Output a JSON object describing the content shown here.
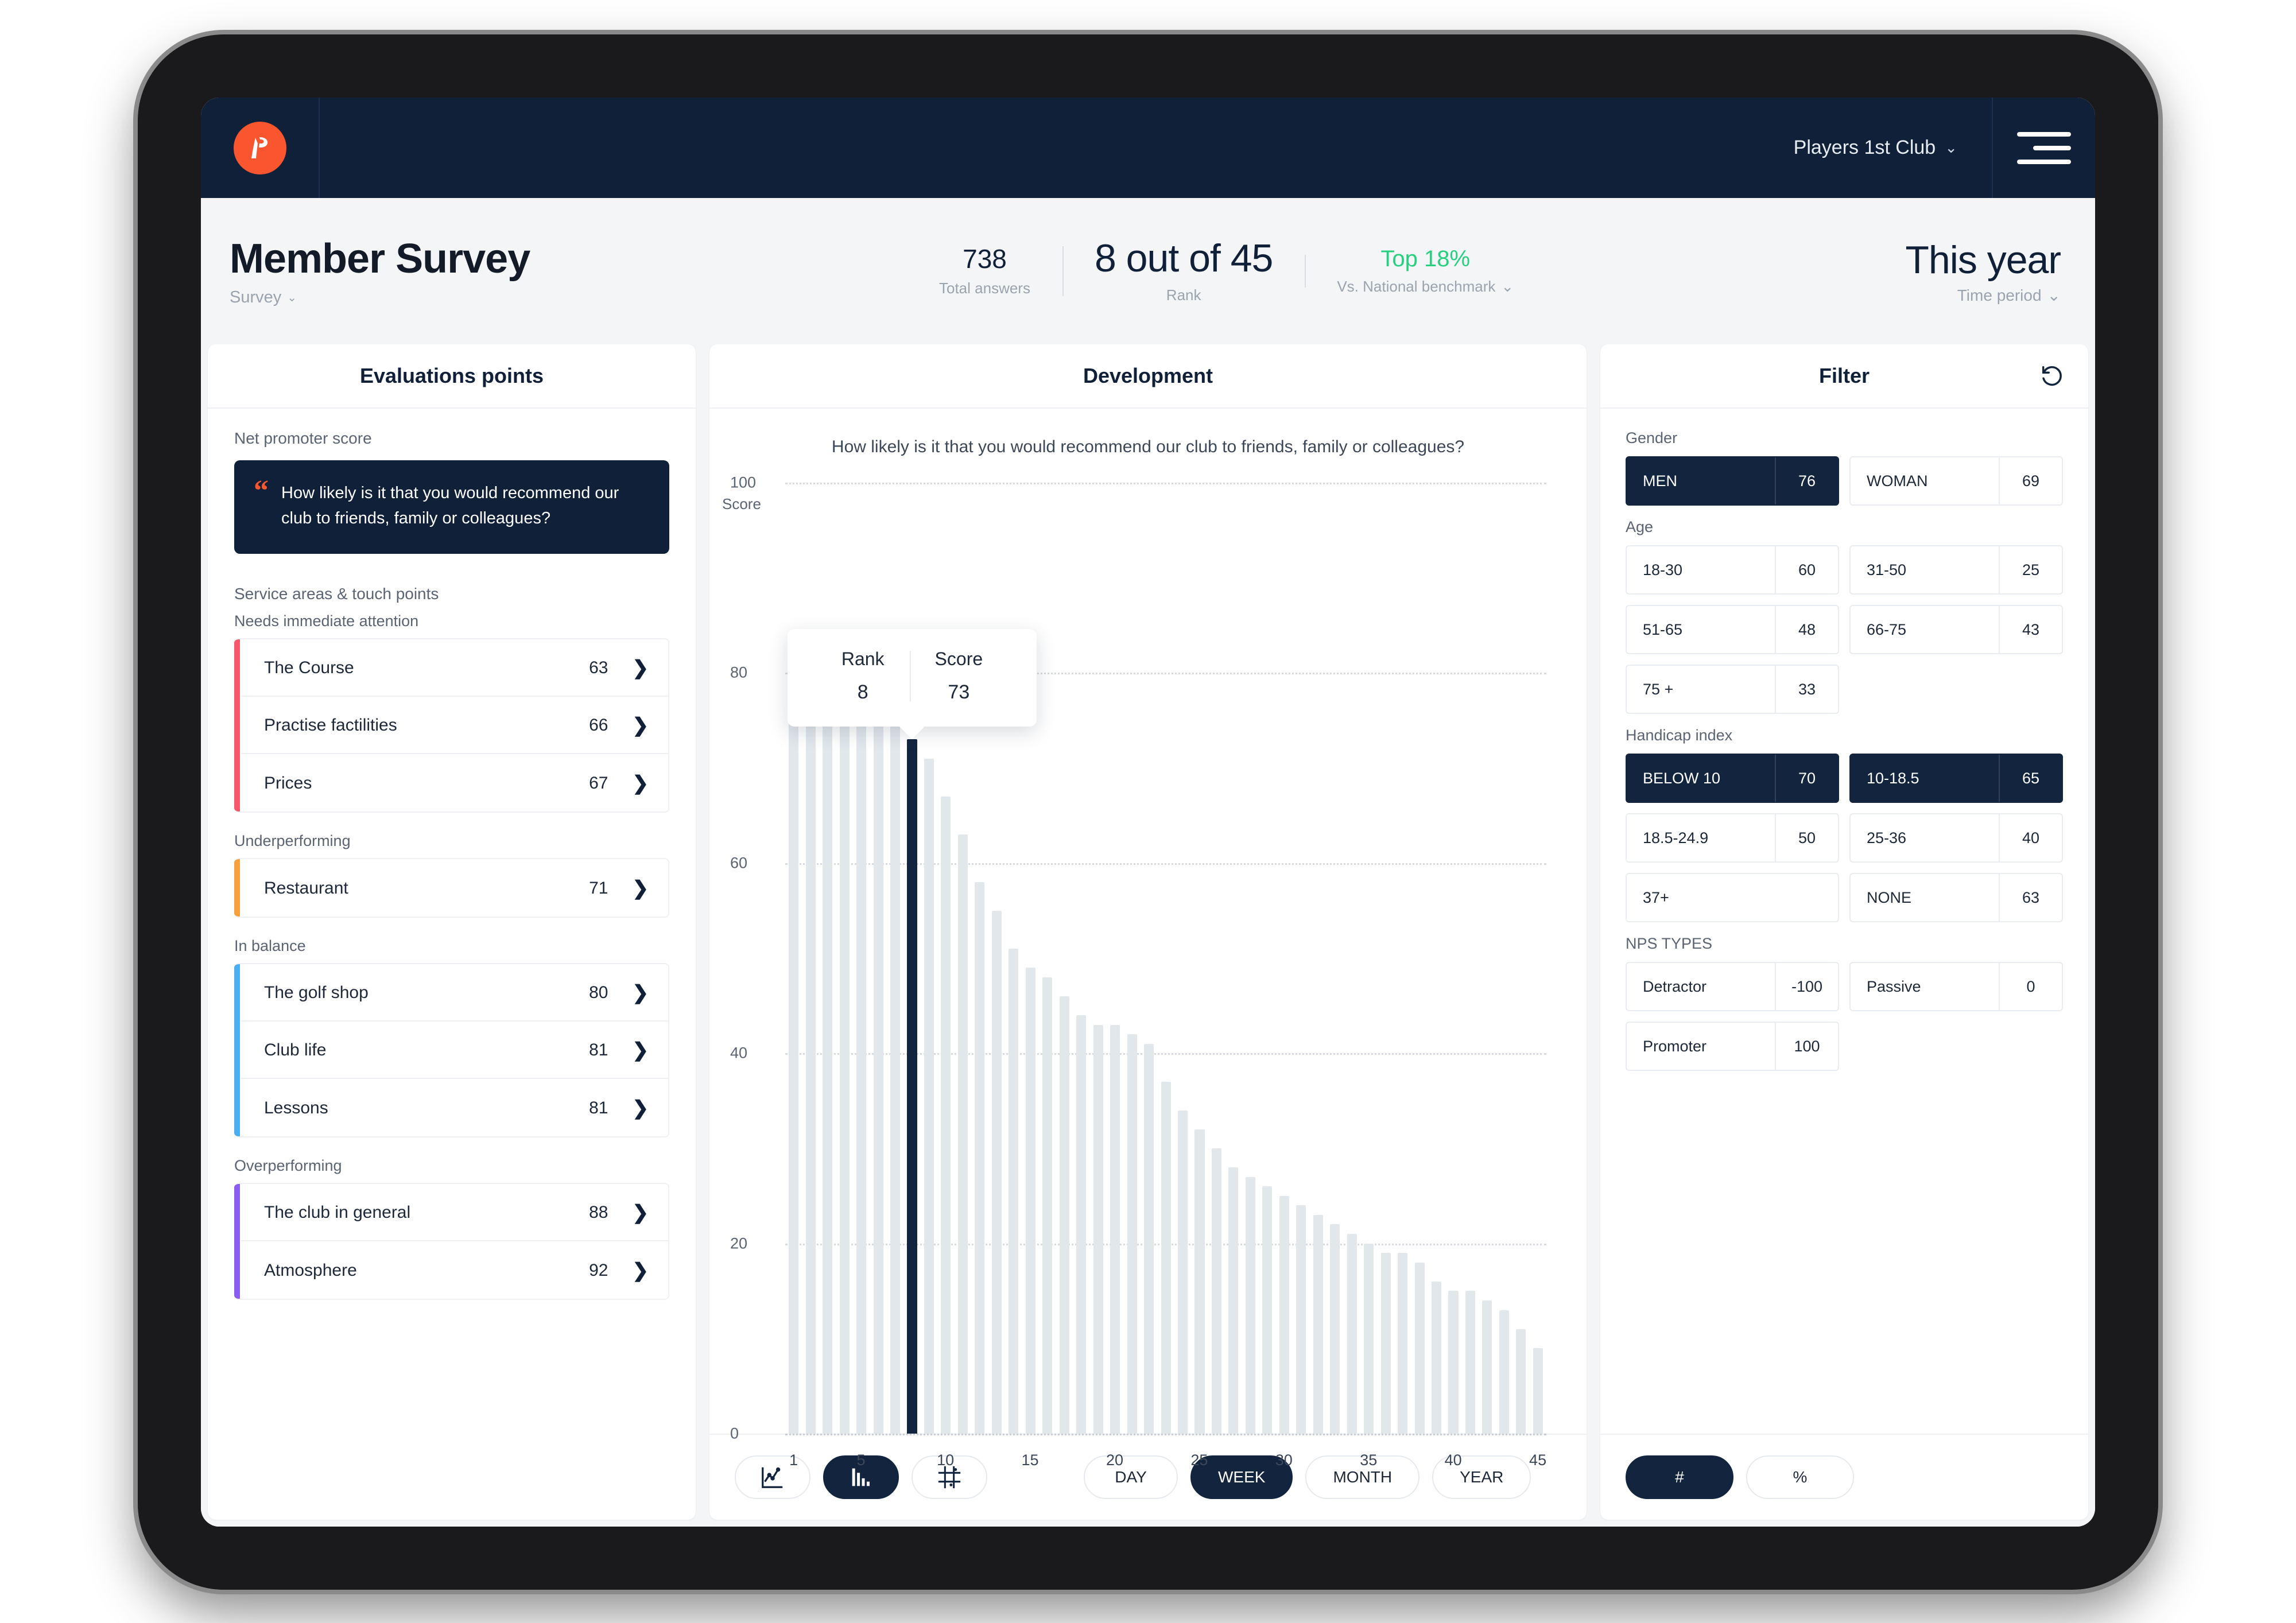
{
  "nav": {
    "logo_icon": "players-1st-logo-icon",
    "club_name": "Players 1st Club",
    "club_chevron": "⌄",
    "menu_icon": "hamburger-menu-icon"
  },
  "header": {
    "title": "Member Survey",
    "subtitle": "Survey",
    "subtitle_chevron": "⌄",
    "kpis": [
      {
        "value": "738",
        "label": "Total answers"
      },
      {
        "value": "8 out of 45",
        "label": "Rank"
      },
      {
        "value": "Top 18%",
        "label": "Vs. National benchmark",
        "chevron": "⌄",
        "color": "#27d07f"
      }
    ],
    "period_value": "This year",
    "period_label": "Time period",
    "period_chevron": "⌄"
  },
  "left_panel": {
    "title": "Evaluations points",
    "nps_label": "Net promoter score",
    "nps_quote_icon": "quote-icon",
    "nps_question": "How likely is it that you would recommend our club to friends, family or colleagues?",
    "service_label": "Service areas & touch points",
    "groups": [
      {
        "title": "Needs immediate attention",
        "accent": "#f8566a",
        "items": [
          {
            "name": "The Course",
            "score": "63"
          },
          {
            "name": "Practise factilities",
            "score": "66"
          },
          {
            "name": "Prices",
            "score": "67"
          }
        ]
      },
      {
        "title": "Underperforming",
        "accent": "#f9a03c",
        "items": [
          {
            "name": "Restaurant",
            "score": "71"
          }
        ]
      },
      {
        "title": "In balance",
        "accent": "#4aaef3",
        "items": [
          {
            "name": "The golf shop",
            "score": "80"
          },
          {
            "name": "Club life",
            "score": "81"
          },
          {
            "name": "Lessons",
            "score": "81"
          }
        ]
      },
      {
        "title": "Overperforming",
        "accent": "#8b5cf0",
        "items": [
          {
            "name": "The club in general",
            "score": "88"
          },
          {
            "name": "Atmosphere",
            "score": "92"
          }
        ]
      }
    ]
  },
  "center_panel": {
    "title": "Development",
    "question": "How likely is it that you would recommend our club to friends, family or colleagues?",
    "tooltip": {
      "rank_label": "Rank",
      "rank_value": "8",
      "score_label": "Score",
      "score_value": "73"
    },
    "chart_type_buttons": [
      {
        "icon": "line-chart-icon",
        "active": false
      },
      {
        "icon": "bar-chart-icon",
        "active": true
      },
      {
        "icon": "scatter-grid-icon",
        "active": false
      }
    ],
    "range_buttons": [
      {
        "label": "DAY",
        "active": false
      },
      {
        "label": "WEEK",
        "active": true
      },
      {
        "label": "MONTH",
        "active": false
      },
      {
        "label": "YEAR",
        "active": false
      }
    ]
  },
  "chart_data": {
    "type": "bar",
    "title": "How likely is it that you would recommend our club to friends, family or colleagues?",
    "xlabel": "",
    "ylabel": "Score",
    "ylim": [
      0,
      100
    ],
    "yticks": [
      0,
      20,
      40,
      60,
      80,
      100
    ],
    "xticks": [
      1,
      5,
      10,
      15,
      20,
      25,
      30,
      35,
      40,
      45
    ],
    "grid": true,
    "highlight_index": 8,
    "highlight_color": "#13243f",
    "bar_color": "#e2e7ec",
    "categories": [
      1,
      2,
      3,
      4,
      5,
      6,
      7,
      8,
      9,
      10,
      11,
      12,
      13,
      14,
      15,
      16,
      17,
      18,
      19,
      20,
      21,
      22,
      23,
      24,
      25,
      26,
      27,
      28,
      29,
      30,
      31,
      32,
      33,
      34,
      35,
      36,
      37,
      38,
      39,
      40,
      41,
      42,
      43,
      44,
      45
    ],
    "values": [
      82,
      82,
      82,
      81,
      79,
      78,
      76,
      73,
      71,
      67,
      63,
      58,
      55,
      51,
      49,
      48,
      46,
      44,
      43,
      43,
      42,
      41,
      37,
      34,
      32,
      30,
      28,
      27,
      26,
      25,
      24,
      23,
      22,
      21,
      20,
      19,
      19,
      18,
      16,
      15,
      15,
      14,
      13,
      11,
      9
    ]
  },
  "right_panel": {
    "title": "Filter",
    "reset_icon": "reset-icon",
    "sections": [
      {
        "label": "Gender",
        "chips": [
          {
            "name": "MEN",
            "value": "76",
            "selected": true
          },
          {
            "name": "WOMAN",
            "value": "69",
            "selected": false
          }
        ]
      },
      {
        "label": "Age",
        "chips": [
          {
            "name": "18-30",
            "value": "60",
            "selected": false
          },
          {
            "name": "31-50",
            "value": "25",
            "selected": false
          },
          {
            "name": "51-65",
            "value": "48",
            "selected": false
          },
          {
            "name": "66-75",
            "value": "43",
            "selected": false
          },
          {
            "name": "75 +",
            "value": "33",
            "selected": false
          }
        ]
      },
      {
        "label": "Handicap index",
        "chips": [
          {
            "name": "BELOW 10",
            "value": "70",
            "selected": true
          },
          {
            "name": "10-18.5",
            "value": "65",
            "selected": true
          },
          {
            "name": "18.5-24.9",
            "value": "50",
            "selected": false
          },
          {
            "name": "25-36",
            "value": "40",
            "selected": false
          },
          {
            "name": "37+",
            "value": "",
            "selected": false
          },
          {
            "name": "NONE",
            "value": "63",
            "selected": false
          }
        ]
      },
      {
        "label": "NPS TYPES",
        "chips": [
          {
            "name": "Detractor",
            "value": "-100",
            "selected": false
          },
          {
            "name": "Passive",
            "value": "0",
            "selected": false
          },
          {
            "name": "Promoter",
            "value": "100",
            "selected": false
          }
        ]
      }
    ],
    "footer_buttons": [
      {
        "label": "#",
        "active": true
      },
      {
        "label": "%",
        "active": false
      }
    ]
  }
}
